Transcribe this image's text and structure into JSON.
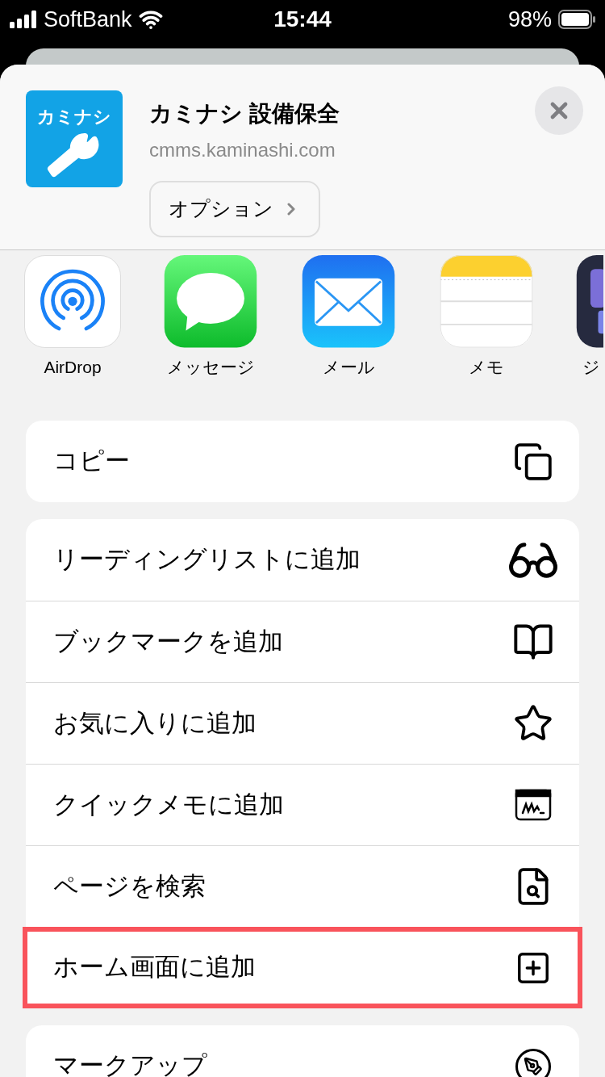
{
  "status_bar": {
    "carrier": "SoftBank",
    "time": "15:44",
    "battery": "98%"
  },
  "header": {
    "app_icon_text": "カミナシ",
    "title": "カミナシ 設備保全",
    "url": "cmms.kaminashi.com",
    "options_button": "オプション"
  },
  "share_apps": [
    {
      "kind": "airdrop",
      "label": "AirDrop"
    },
    {
      "kind": "messages",
      "label": "メッセージ"
    },
    {
      "kind": "mail",
      "label": "メール"
    },
    {
      "kind": "notes",
      "label": "メモ"
    },
    {
      "kind": "partial",
      "label": "ジ"
    }
  ],
  "action_groups": [
    [
      {
        "kind": "copy",
        "label": "コピー",
        "highlighted": false
      }
    ],
    [
      {
        "kind": "reading-list",
        "label": "リーディングリストに追加",
        "highlighted": false
      },
      {
        "kind": "bookmark",
        "label": "ブックマークを追加",
        "highlighted": false
      },
      {
        "kind": "favorite",
        "label": "お気に入りに追加",
        "highlighted": false
      },
      {
        "kind": "quick-note",
        "label": "クイックメモに追加",
        "highlighted": false
      },
      {
        "kind": "find",
        "label": "ページを検索",
        "highlighted": false
      },
      {
        "kind": "home-screen",
        "label": "ホーム画面に追加",
        "highlighted": true
      }
    ],
    [
      {
        "kind": "markup",
        "label": "マークアップ",
        "highlighted": false
      }
    ]
  ]
}
